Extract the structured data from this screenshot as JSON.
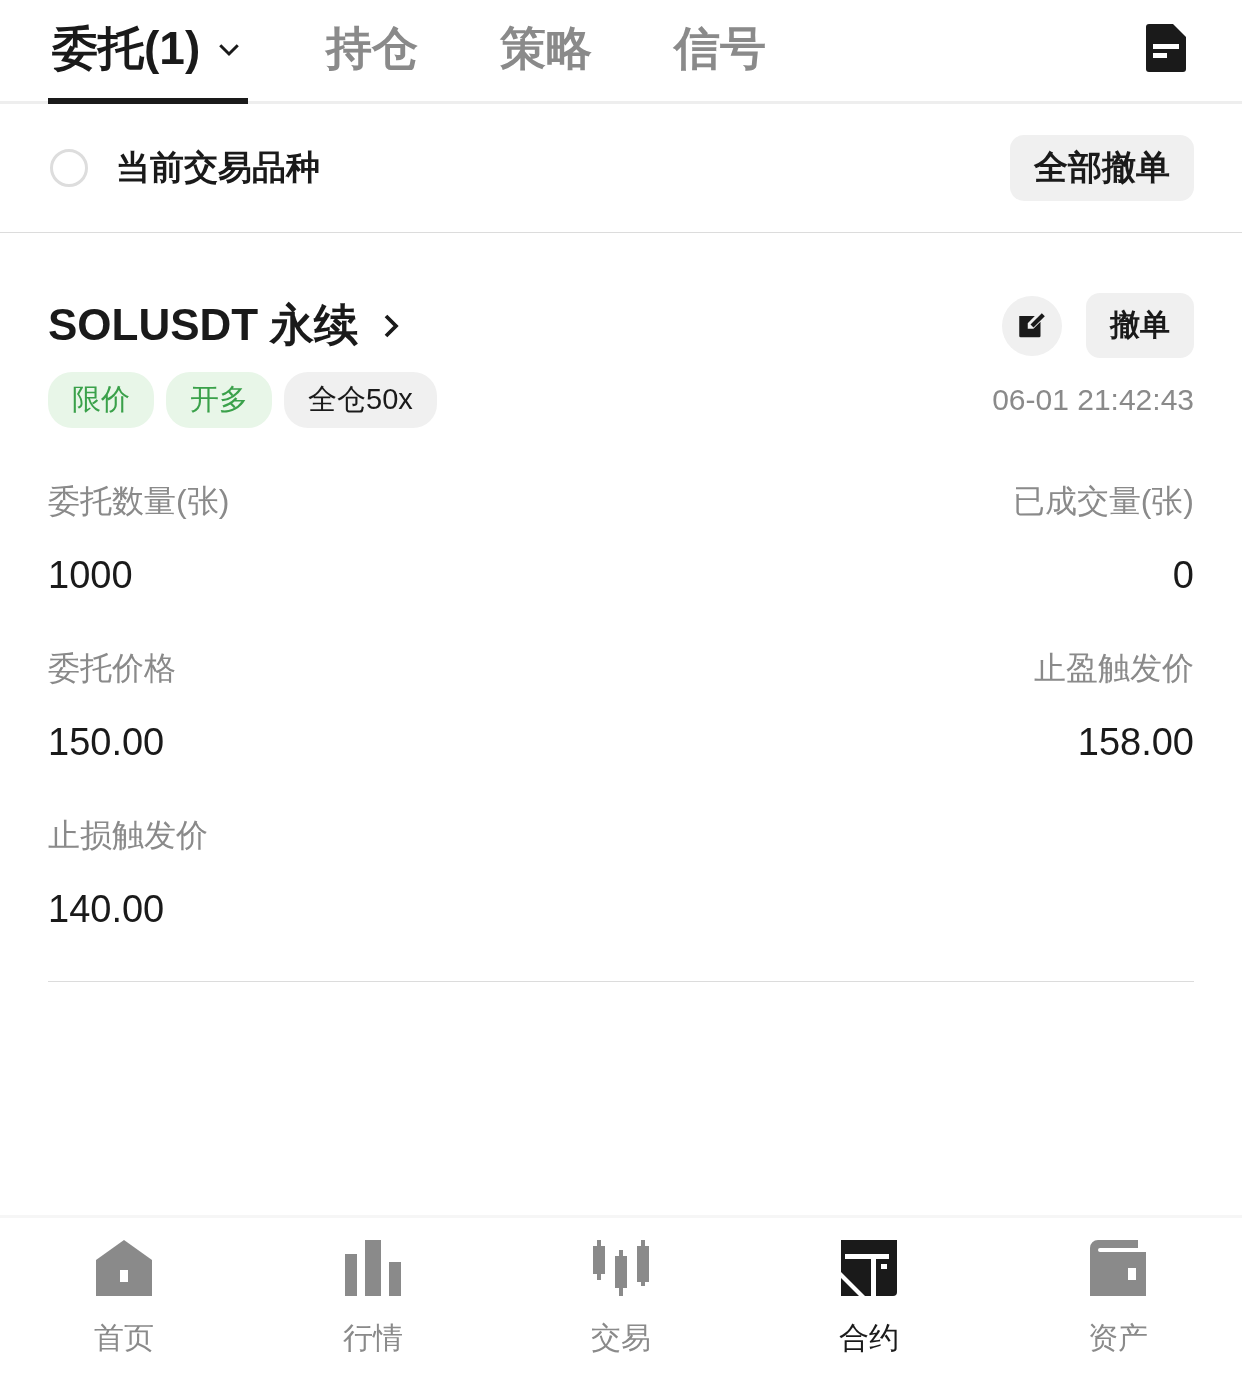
{
  "tabs": [
    {
      "label": "委托(1)",
      "selected": true,
      "dropdown": true
    },
    {
      "label": "持仓",
      "selected": false,
      "dropdown": false
    },
    {
      "label": "策略",
      "selected": false,
      "dropdown": false
    },
    {
      "label": "信号",
      "selected": false,
      "dropdown": false
    }
  ],
  "filter": {
    "label": "当前交易品种",
    "checked": false,
    "cancel_all": "全部撤单"
  },
  "order": {
    "symbol": "SOLUSDT 永续",
    "cancel": "撤单",
    "time": "06-01 21:42:43",
    "tags": [
      {
        "label": "限价",
        "kind": "accent"
      },
      {
        "label": "开多",
        "kind": "accent"
      },
      {
        "label": "全仓50x",
        "kind": "plain"
      }
    ],
    "fields": [
      {
        "label": "委托数量(张)",
        "value": "1000"
      },
      {
        "label": "已成交量(张)",
        "value": "0"
      },
      {
        "label": "委托价格",
        "value": "150.00"
      },
      {
        "label": "止盈触发价",
        "value": "158.00"
      },
      {
        "label": "止损触发价",
        "value": "140.00"
      }
    ]
  },
  "nav": [
    {
      "label": "首页",
      "selected": false
    },
    {
      "label": "行情",
      "selected": false
    },
    {
      "label": "交易",
      "selected": false
    },
    {
      "label": "合约",
      "selected": true
    },
    {
      "label": "资产",
      "selected": false
    }
  ]
}
